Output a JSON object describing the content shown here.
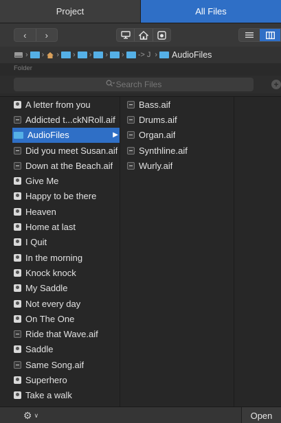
{
  "tabs": [
    {
      "label": "Project",
      "active": false
    },
    {
      "label": "All Files",
      "active": true
    }
  ],
  "toolbar": {
    "back_icon": "chevron-left-icon",
    "forward_icon": "chevron-right-icon",
    "computer_icon": "monitor-icon",
    "home_icon": "home-icon",
    "project_icon": "project-icon",
    "list_view_icon": "list-view-icon",
    "column_view_icon": "column-view-icon"
  },
  "path": {
    "arrow_text": "-> J",
    "current": "AudioFiles",
    "folder_label": "Folder"
  },
  "search": {
    "placeholder": "Search Files"
  },
  "columns": {
    "col1": [
      {
        "label": "A letter from you",
        "icon": "song"
      },
      {
        "label": "Addicted t...ckNRoll.aif",
        "icon": "audio"
      },
      {
        "label": "AudioFiles",
        "icon": "folder",
        "selected": true
      },
      {
        "label": "Did you meet Susan.aif",
        "icon": "audio"
      },
      {
        "label": "Down at the Beach.aif",
        "icon": "audio"
      },
      {
        "label": "Give Me",
        "icon": "song"
      },
      {
        "label": "Happy to be there",
        "icon": "song"
      },
      {
        "label": "Heaven",
        "icon": "song"
      },
      {
        "label": "Home at last",
        "icon": "song"
      },
      {
        "label": "I Quit",
        "icon": "song"
      },
      {
        "label": "In the morning",
        "icon": "song"
      },
      {
        "label": "Knock knock",
        "icon": "song"
      },
      {
        "label": "My Saddle",
        "icon": "song"
      },
      {
        "label": "Not every day",
        "icon": "song"
      },
      {
        "label": "On The One",
        "icon": "song"
      },
      {
        "label": "Ride that Wave.aif",
        "icon": "audio"
      },
      {
        "label": "Saddle",
        "icon": "song"
      },
      {
        "label": "Same Song.aif",
        "icon": "audio"
      },
      {
        "label": "Superhero",
        "icon": "song"
      },
      {
        "label": "Take a walk",
        "icon": "song"
      }
    ],
    "col2": [
      {
        "label": "Bass.aif",
        "icon": "audio"
      },
      {
        "label": "Drums.aif",
        "icon": "audio"
      },
      {
        "label": "Organ.aif",
        "icon": "audio"
      },
      {
        "label": "Synthline.aif",
        "icon": "audio"
      },
      {
        "label": "Wurly.aif",
        "icon": "audio"
      }
    ]
  },
  "bottom": {
    "open_label": "Open",
    "action_icon": "gear-icon"
  },
  "colors": {
    "accent": "#2f6fc6",
    "folder": "#55b0e6",
    "background": "#272727"
  }
}
